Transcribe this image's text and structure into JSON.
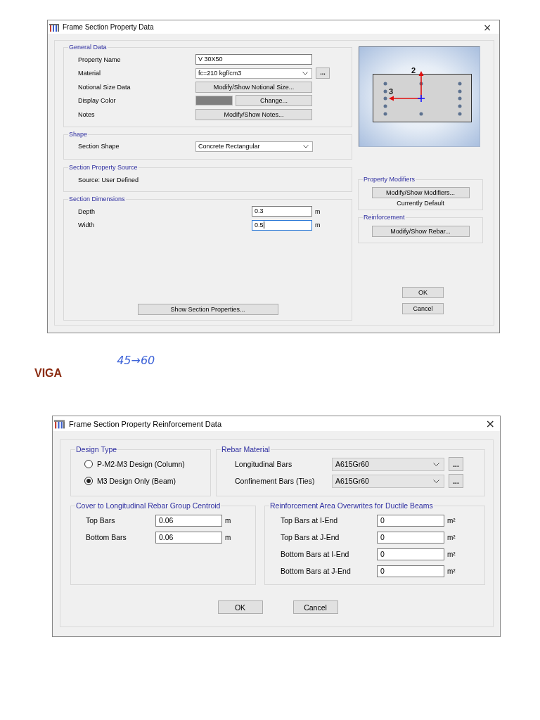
{
  "section_window": {
    "title": "Frame Section Property Data",
    "close": "×",
    "general_data": {
      "title": "General Data",
      "rows": [
        {
          "kind": "text",
          "label": "Property Name",
          "value": "V 30X50"
        },
        {
          "kind": "dropdown",
          "label": "Material",
          "value": "fc=210 kgf/cm3",
          "more": "..."
        },
        {
          "kind": "button",
          "label": "Notional Size Data",
          "button": "Modify/Show Notional Size..."
        },
        {
          "kind": "color",
          "label": "Display Color",
          "color": "#7f7f7f",
          "button": "Change..."
        },
        {
          "kind": "button",
          "label": "Notes",
          "button": "Modify/Show Notes..."
        }
      ]
    },
    "shape": {
      "title": "Shape",
      "label": "Section Shape",
      "value": "Concrete Rectangular"
    },
    "property_source": {
      "title": "Section Property Source",
      "text": "Source:  User Defined"
    },
    "dimensions": {
      "title": "Section Dimensions",
      "rows": [
        {
          "label": "Depth",
          "value": "0.3",
          "unit": "m",
          "focused": false
        },
        {
          "label": "Width",
          "value": "0.5",
          "unit": "m",
          "focused": true
        }
      ],
      "button": "Show Section Properties..."
    },
    "preview": {
      "axis_labels": [
        "2",
        "3"
      ]
    },
    "property_modifiers": {
      "title": "Property Modifiers",
      "button": "Modify/Show Modifiers...",
      "status": "Currently Default"
    },
    "reinforcement": {
      "title": "Reinforcement",
      "button": "Modify/Show Rebar..."
    },
    "buttons": [
      "OK",
      "Cancel"
    ]
  },
  "caption": "VIGA",
  "note": "45→60",
  "rebar_window": {
    "title": "Frame Section Property Reinforcement Data",
    "close": "×",
    "design_type": {
      "title": "Design Type",
      "options": [
        {
          "label": "P-M2-M3 Design  (Column)",
          "selected": false
        },
        {
          "label": "M3 Design Only  (Beam)",
          "selected": true
        }
      ]
    },
    "rebar_material": {
      "title": "Rebar Material",
      "rows": [
        {
          "label": "Longitudinal Bars",
          "value": "A615Gr60",
          "more": "..."
        },
        {
          "label": "Confinement Bars (Ties)",
          "value": "A615Gr60",
          "more": "..."
        }
      ]
    },
    "cover": {
      "title": "Cover to Longitudinal Rebar Group Centroid",
      "rows": [
        {
          "label": "Top Bars",
          "value": "0.06",
          "unit": "m"
        },
        {
          "label": "Bottom  Bars",
          "value": "0.06",
          "unit": "m"
        }
      ]
    },
    "area_overwrites": {
      "title": "Reinforcement Area Overwrites for Ductile Beams",
      "rows": [
        {
          "label": "Top Bars at I-End",
          "value": "0",
          "unit": "m²"
        },
        {
          "label": "Top Bars at J-End",
          "value": "0",
          "unit": "m²"
        },
        {
          "label": "Bottom Bars at I-End",
          "value": "0",
          "unit": "m²"
        },
        {
          "label": "Bottom Bars at J-End",
          "value": "0",
          "unit": "m²"
        }
      ]
    },
    "buttons": [
      "OK",
      "Cancel"
    ]
  }
}
